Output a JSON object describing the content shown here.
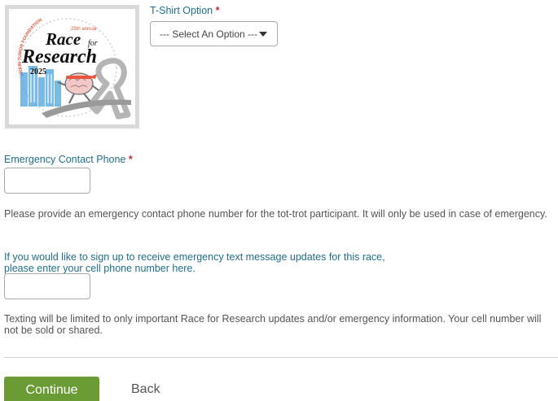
{
  "logo": {
    "arc_text": "BRAIN TUMOR FOUNDATION",
    "annual": "25th annual",
    "race": "Race",
    "for": "for",
    "research": "Research",
    "year": "2025",
    "colors": {
      "title": "#111111",
      "accent": "#e8563f",
      "ribbon": "#b5b5b5",
      "city": "#4aa3df"
    }
  },
  "tshirt": {
    "label": "T-Shirt Option",
    "required_mark": "*",
    "selected": "--- Select An Option ---"
  },
  "emergency_phone": {
    "label": "Emergency Contact Phone",
    "required_mark": "*",
    "value": "",
    "help": "Please provide an emergency contact phone number for the tot-trot participant. It will only be used in case of emergency."
  },
  "text_updates": {
    "label_line1": "If you would like to sign up to receive emergency text message updates for this race,",
    "label_line2": "please enter your cell phone number here.",
    "value": "",
    "help": "Texting will be limited to only important Race for Research updates and/or emergency information. Your cell number will not be sold or shared."
  },
  "actions": {
    "continue_label": "Continue",
    "back_label": "Back",
    "continue_color": "#6a9b34"
  }
}
